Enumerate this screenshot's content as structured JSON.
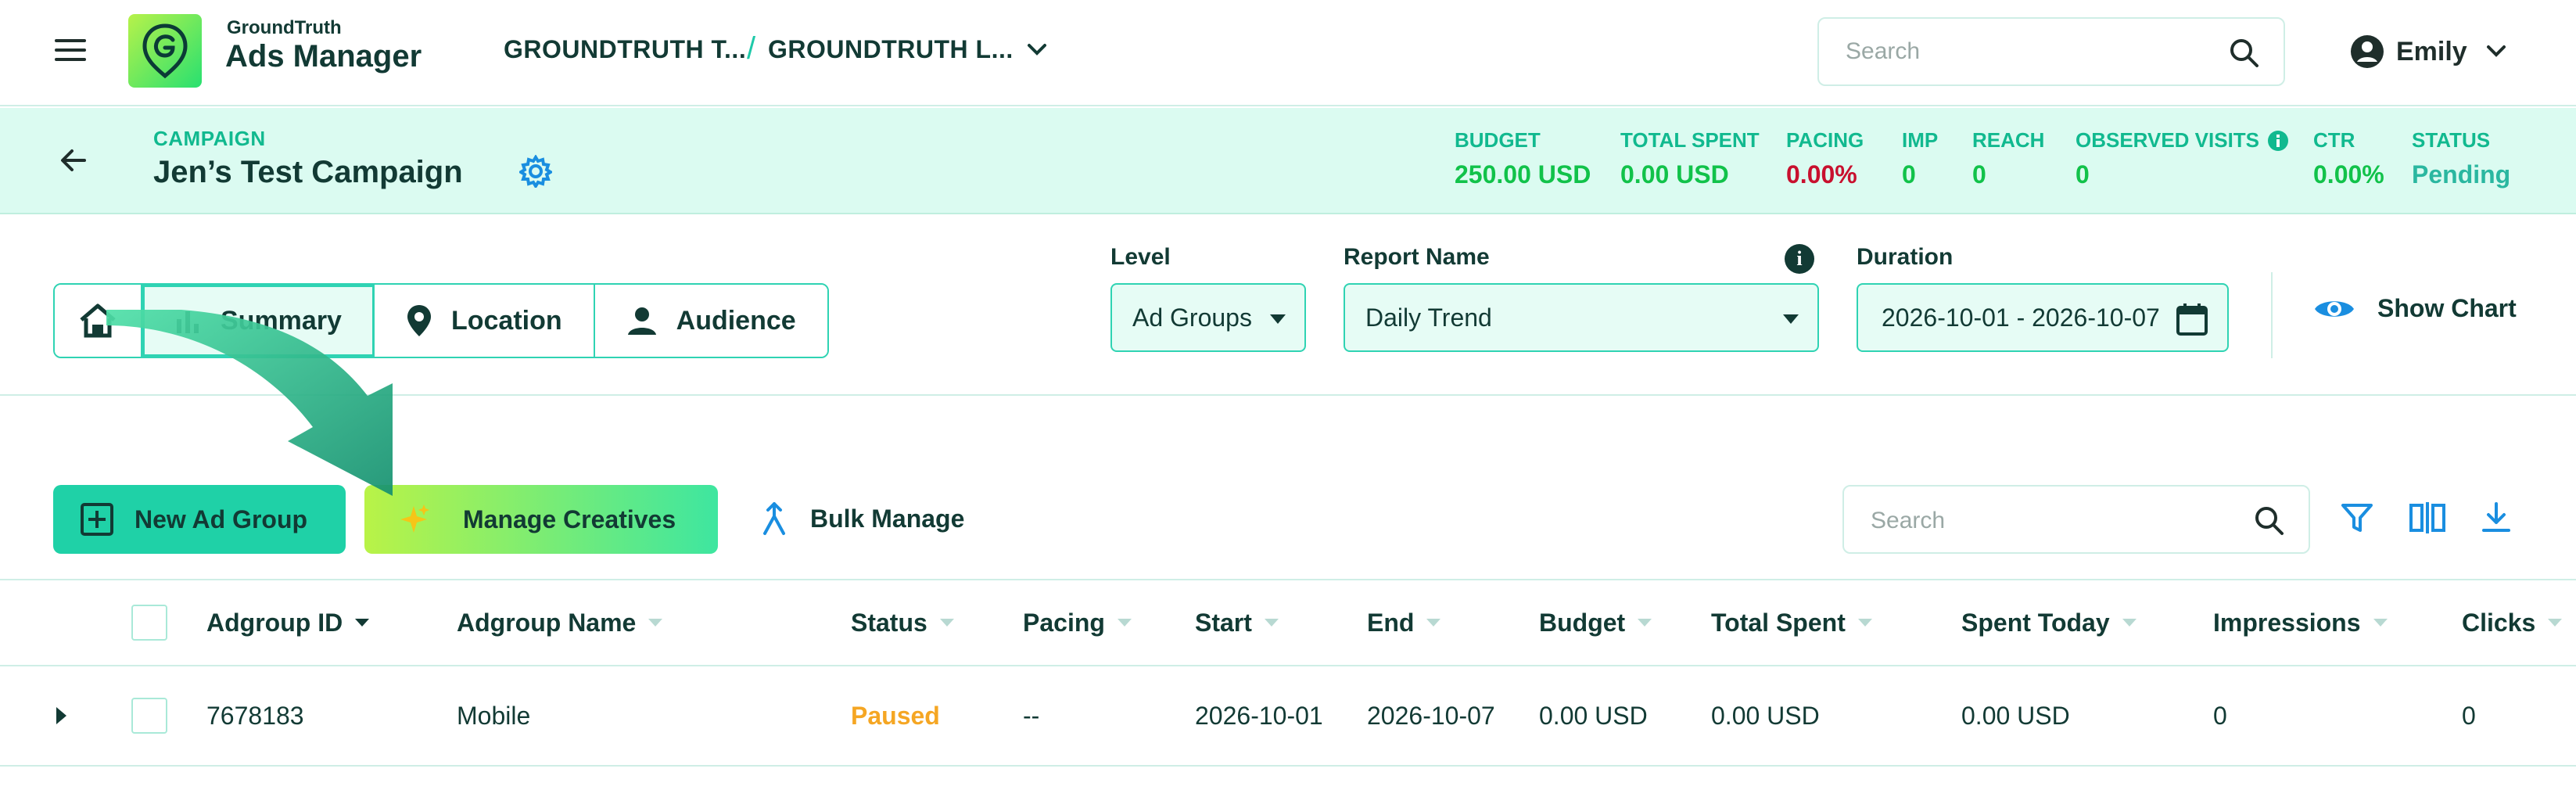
{
  "app": {
    "brand_small": "GroundTruth",
    "brand_big": "Ads Manager",
    "breadcrumb": [
      "GROUNDTRUTH T...",
      "GROUNDTRUTH L..."
    ],
    "breadcrumb_separator": "/",
    "search_placeholder": "Search",
    "user_name": "Emily"
  },
  "campaign": {
    "label": "CAMPAIGN",
    "name": "Jen’s Test Campaign",
    "metrics": {
      "budget": {
        "label": "BUDGET",
        "value": "250.00 USD"
      },
      "spent": {
        "label": "TOTAL SPENT",
        "value": "0.00 USD"
      },
      "pacing": {
        "label": "PACING",
        "value": "0.00%"
      },
      "imp": {
        "label": "IMP",
        "value": "0"
      },
      "reach": {
        "label": "REACH",
        "value": "0"
      },
      "visits": {
        "label": "OBSERVED VISITS",
        "value": "0"
      },
      "ctr": {
        "label": "CTR",
        "value": "0.00%"
      },
      "status": {
        "label": "STATUS",
        "value": "Pending"
      }
    }
  },
  "tabs": {
    "summary": "Summary",
    "location": "Location",
    "audience": "Audience",
    "active": "summary"
  },
  "filters": {
    "level_label": "Level",
    "level_value": "Ad Groups",
    "report_label": "Report Name",
    "report_value": "Daily Trend",
    "duration_label": "Duration",
    "duration_value": "2026-10-01 - 2026-10-07",
    "show_chart": "Show Chart"
  },
  "actions": {
    "new_ad_group": "New Ad Group",
    "manage_creatives": "Manage Creatives",
    "bulk_manage": "Bulk Manage",
    "search_placeholder": "Search"
  },
  "table": {
    "columns": [
      "Adgroup ID",
      "Adgroup Name",
      "Status",
      "Pacing",
      "Start",
      "End",
      "Budget",
      "Total Spent",
      "Spent Today",
      "Impressions",
      "Clicks"
    ],
    "rows": [
      {
        "id": "7678183",
        "name": "Mobile",
        "status": "Paused",
        "pacing": "--",
        "start": "2026-10-01",
        "end": "2026-10-07",
        "budget": "0.00 USD",
        "total_spent": "0.00 USD",
        "spent_today": "0.00 USD",
        "impressions": "0",
        "clicks": "0"
      }
    ]
  },
  "colors": {
    "accent": "#1fd1a7",
    "metric_green": "#11c24a",
    "metric_red": "#c8102e",
    "status_pending": "#2ab7a0",
    "status_paused": "#f5a623",
    "icon_blue": "#1a8ee0"
  }
}
